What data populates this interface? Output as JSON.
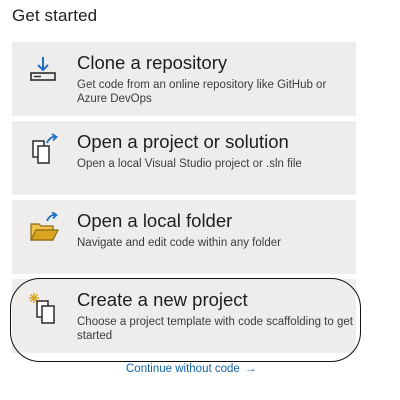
{
  "heading": "Get started",
  "cards": [
    {
      "title": "Clone a repository",
      "description": "Get code from an online repository like GitHub or Azure DevOps",
      "icon": "download-clone-icon"
    },
    {
      "title": "Open a project or solution",
      "description": "Open a local Visual Studio project or .sln file",
      "icon": "open-project-icon"
    },
    {
      "title": "Open a local folder",
      "description": "Navigate and edit code within any folder",
      "icon": "open-folder-icon"
    },
    {
      "title": "Create a new project",
      "description": "Choose a project template with code scaffolding to get started",
      "icon": "new-project-icon"
    }
  ],
  "continue_link": {
    "label": "Continue without code",
    "arrow": "→"
  },
  "colors": {
    "card_background": "#efedeb",
    "accent_blue": "#1e6fc4",
    "folder_yellow": "#d9a520",
    "link": "#1565a8"
  }
}
